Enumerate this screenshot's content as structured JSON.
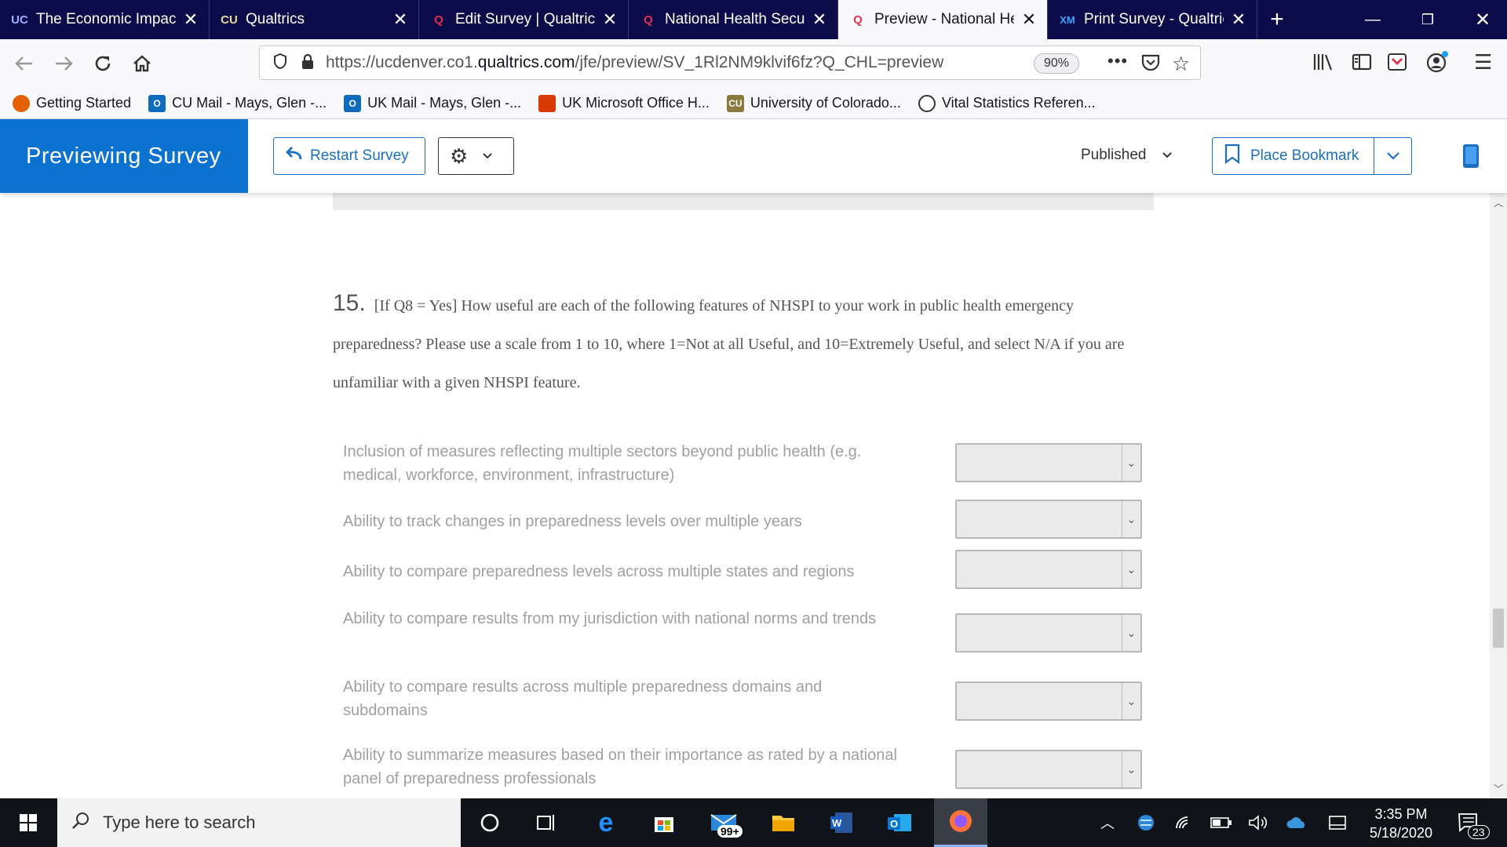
{
  "browser": {
    "tabs": [
      {
        "title": "The Economic Impact",
        "favicon": "UC"
      },
      {
        "title": "Qualtrics",
        "favicon": "CU"
      },
      {
        "title": "Edit Survey | Qualtrics",
        "favicon": "Q"
      },
      {
        "title": "National Health Securi",
        "favicon": "Q"
      },
      {
        "title": "Preview - National He",
        "favicon": "Q",
        "active": true
      },
      {
        "title": "Print Survey - Qualtric",
        "favicon": "XM"
      }
    ],
    "url_prefix": "https://ucdenver.co1.",
    "url_domain": "qualtrics.com",
    "url_path": "/jfe/preview/SV_1Rl2NM9klvif6fz?Q_CHL=preview",
    "zoom": "90%",
    "bookmarks": [
      {
        "label": "Getting Started",
        "color": "#e66000"
      },
      {
        "label": "CU Mail - Mays, Glen -...",
        "color": "#0f6cbd"
      },
      {
        "label": "UK Mail - Mays, Glen -...",
        "color": "#0f6cbd"
      },
      {
        "label": "UK Microsoft Office H...",
        "color": "#d83b01"
      },
      {
        "label": "University of Colorado...",
        "color": "#8a7a3d"
      },
      {
        "label": "Vital Statistics Referen...",
        "color": "#333333"
      }
    ]
  },
  "qualtrics": {
    "brand": "Previewing Survey",
    "restart_label": "Restart Survey",
    "status": "Published",
    "bookmark_label": "Place Bookmark"
  },
  "question": {
    "number": "15.",
    "text": "[If Q8 = Yes] How useful are each of the following features of NHSPI to your work in public health emergency preparedness? Please use a scale from 1 to 10, where 1=Not at all Useful, and 10=Extremely Useful, and select N/A if you are unfamiliar with a given NHSPI feature.",
    "rows": [
      {
        "label": "Inclusion of measures reflecting multiple sectors beyond public health (e.g. medical, workforce, environment, infrastructure)",
        "value": ""
      },
      {
        "label": "Ability to track changes in preparedness levels over multiple years",
        "value": ""
      },
      {
        "label": "Ability to compare preparedness levels across multiple states and regions",
        "value": ""
      },
      {
        "label": "Ability to compare results from my jurisdiction with national norms and trends",
        "value": ""
      },
      {
        "label": "Ability to compare results across multiple preparedness domains and subdomains",
        "value": ""
      },
      {
        "label": "Ability to summarize measures based on their importance as rated by a national panel of preparedness professionals",
        "value": ""
      }
    ]
  },
  "taskbar": {
    "search_placeholder": "Type here to search",
    "mail_badge": "99+",
    "time": "3:35 PM",
    "date": "5/18/2020",
    "notifications": "23"
  }
}
